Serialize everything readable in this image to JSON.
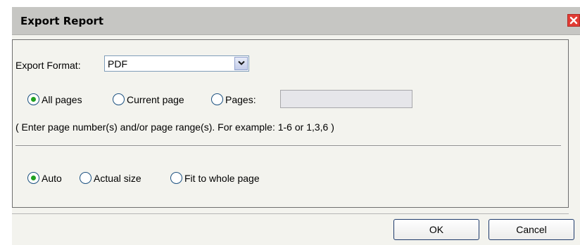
{
  "dialog": {
    "title": "Export Report",
    "close_icon": "close-icon",
    "accent_color": "#e23c34"
  },
  "format": {
    "label": "Export Format:",
    "value": "PDF",
    "arrow_icon": "chevron-down-icon"
  },
  "page_range": {
    "options": [
      {
        "label": "All pages",
        "checked": true
      },
      {
        "label": "Current page",
        "checked": false
      },
      {
        "label": "Pages:",
        "checked": false
      }
    ],
    "pages_input_value": "",
    "hint": "( Enter page number(s) and/or page range(s). For example: 1-6 or 1,3,6 )"
  },
  "size": {
    "options": [
      {
        "label": "Auto",
        "checked": true
      },
      {
        "label": "Actual size",
        "checked": false
      },
      {
        "label": "Fit to whole page",
        "checked": false
      }
    ]
  },
  "buttons": {
    "ok": "OK",
    "cancel": "Cancel"
  }
}
